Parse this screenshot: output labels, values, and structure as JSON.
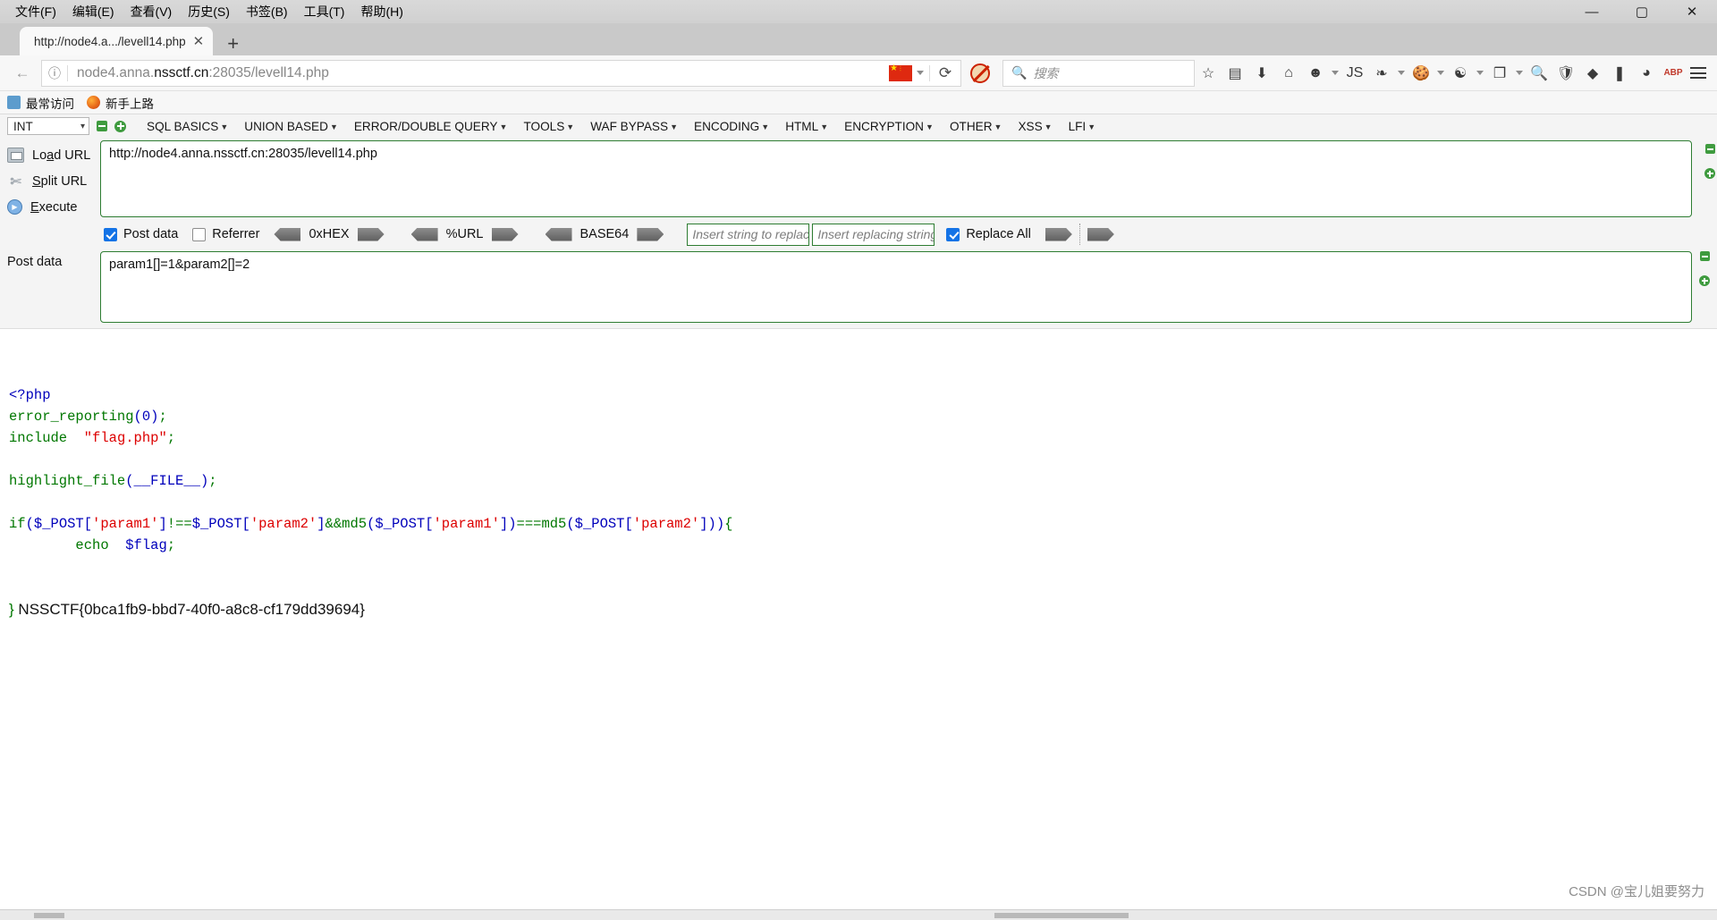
{
  "window": {
    "menu": [
      {
        "label": "文件(F)"
      },
      {
        "label": "编辑(E)"
      },
      {
        "label": "查看(V)"
      },
      {
        "label": "历史(S)"
      },
      {
        "label": "书签(B)"
      },
      {
        "label": "工具(T)"
      },
      {
        "label": "帮助(H)"
      }
    ],
    "minimize": "—",
    "maximize": "▢",
    "close": "✕"
  },
  "tabs": {
    "active": {
      "title": "http://node4.a.../levell14.php",
      "close": "✕"
    },
    "new_tab": "+"
  },
  "nav": {
    "back": "←",
    "identity_icon": "ⓘ",
    "url_prefix": "node4.anna.",
    "url_domain": "nssctf.cn",
    "url_suffix": ":28035/levell14.php",
    "flag_label": "china-flag",
    "reload": "⟳",
    "noscript": "noscript-icon",
    "search_placeholder": "搜索",
    "search_value": "",
    "icons": [
      {
        "name": "bookmark-star-icon",
        "glyph": "☆"
      },
      {
        "name": "reader-view-icon",
        "glyph": "▤"
      },
      {
        "name": "downloads-icon",
        "glyph": "⬇"
      },
      {
        "name": "home-icon",
        "glyph": "⌂"
      },
      {
        "name": "user-agent-switcher-icon",
        "glyph": "☻"
      },
      {
        "name": "javascript-toggle-icon",
        "glyph": "JS"
      },
      {
        "name": "ie-tab-icon",
        "glyph": "❧"
      },
      {
        "name": "cookie-manager-icon",
        "glyph": "🍪"
      },
      {
        "name": "proxy-switcher-icon",
        "glyph": "☯"
      },
      {
        "name": "copy-pages-icon",
        "glyph": "❐"
      },
      {
        "name": "zoom-icon",
        "glyph": "🔍"
      },
      {
        "name": "shield-icon",
        "glyph": "🛡"
      },
      {
        "name": "gem-icon",
        "glyph": "◆"
      },
      {
        "name": "notes-icon",
        "glyph": "❚"
      },
      {
        "name": "globe-icon",
        "glyph": "◕"
      },
      {
        "name": "adblock-icon",
        "glyph": "ABP"
      }
    ]
  },
  "bookmarks": [
    {
      "label": "最常访问",
      "icon": "most-visited-icon"
    },
    {
      "label": "新手上路",
      "icon": "firefox-getting-started-icon"
    }
  ],
  "hackbar": {
    "type_select": "INT",
    "remove_button": "minus",
    "add_button": "plus",
    "menu": [
      {
        "label": "SQL BASICS"
      },
      {
        "label": "UNION BASED"
      },
      {
        "label": "ERROR/DOUBLE QUERY"
      },
      {
        "label": "TOOLS"
      },
      {
        "label": "WAF BYPASS"
      },
      {
        "label": "ENCODING"
      },
      {
        "label": "HTML"
      },
      {
        "label": "ENCRYPTION"
      },
      {
        "label": "OTHER"
      },
      {
        "label": "XSS"
      },
      {
        "label": "LFI"
      }
    ],
    "actions": [
      {
        "label_pre": "Lo",
        "label_key": "a",
        "label_post": "d URL",
        "name": "load-url"
      },
      {
        "label_pre": "",
        "label_key": "S",
        "label_post": "plit URL",
        "name": "split-url"
      },
      {
        "label_pre": "",
        "label_key": "E",
        "label_post": "xecute",
        "name": "execute"
      }
    ],
    "url_value": "http://node4.anna.nssctf.cn:28035/levell14.php",
    "options": {
      "post_data_label": "Post data",
      "post_data_checked": true,
      "referrer_label": "Referrer",
      "referrer_checked": false,
      "hex_label": "0xHEX",
      "url_label": "%URL",
      "base64_label": "BASE64",
      "replace_find_placeholder": "Insert string to replace",
      "replace_with_placeholder": "Insert replacing string",
      "replace_all_label": "Replace All",
      "replace_all_checked": true
    },
    "post_data_label": "Post data",
    "post_data_value": "param1[]=1&param2[]=2"
  },
  "code": {
    "lines": [
      [
        {
          "t": "<?php",
          "c": "c-tag"
        }
      ],
      [
        {
          "t": "error_reporting",
          "c": "c-kw"
        },
        {
          "t": "(",
          "c": "c-fn"
        },
        {
          "t": "0",
          "c": "c-num"
        },
        {
          "t": ")",
          "c": "c-fn"
        },
        {
          "t": ";",
          "c": "c-kw"
        }
      ],
      [
        {
          "t": "include",
          "c": "c-kw"
        },
        {
          "t": "  ",
          "c": ""
        },
        {
          "t": "\"flag.php\"",
          "c": "c-str"
        },
        {
          "t": ";",
          "c": "c-kw"
        }
      ],
      [],
      [
        {
          "t": "highlight_file",
          "c": "c-kw"
        },
        {
          "t": "(",
          "c": "c-fn"
        },
        {
          "t": "__FILE__",
          "c": "c-var"
        },
        {
          "t": ")",
          "c": "c-fn"
        },
        {
          "t": ";",
          "c": "c-kw"
        }
      ],
      [],
      [
        {
          "t": "if",
          "c": "c-kw"
        },
        {
          "t": "(",
          "c": "c-fn"
        },
        {
          "t": "$_POST",
          "c": "c-var"
        },
        {
          "t": "[",
          "c": "c-fn"
        },
        {
          "t": "'param1'",
          "c": "c-str"
        },
        {
          "t": "]",
          "c": "c-fn"
        },
        {
          "t": "!==",
          "c": "c-kw"
        },
        {
          "t": "$_POST",
          "c": "c-var"
        },
        {
          "t": "[",
          "c": "c-fn"
        },
        {
          "t": "'param2'",
          "c": "c-str"
        },
        {
          "t": "]",
          "c": "c-fn"
        },
        {
          "t": "&&",
          "c": "c-kw"
        },
        {
          "t": "md5",
          "c": "c-kw"
        },
        {
          "t": "(",
          "c": "c-fn"
        },
        {
          "t": "$_POST",
          "c": "c-var"
        },
        {
          "t": "[",
          "c": "c-fn"
        },
        {
          "t": "'param1'",
          "c": "c-str"
        },
        {
          "t": "]",
          "c": "c-fn"
        },
        {
          "t": ")",
          "c": "c-fn"
        },
        {
          "t": "===",
          "c": "c-kw"
        },
        {
          "t": "md5",
          "c": "c-kw"
        },
        {
          "t": "(",
          "c": "c-fn"
        },
        {
          "t": "$_POST",
          "c": "c-var"
        },
        {
          "t": "[",
          "c": "c-fn"
        },
        {
          "t": "'param2'",
          "c": "c-str"
        },
        {
          "t": "]",
          "c": "c-fn"
        },
        {
          "t": "))",
          "c": "c-fn"
        },
        {
          "t": "{",
          "c": "c-kw"
        }
      ],
      [
        {
          "t": "        ",
          "c": ""
        },
        {
          "t": "echo",
          "c": "c-kw"
        },
        {
          "t": "  ",
          "c": ""
        },
        {
          "t": "$flag",
          "c": "c-var"
        },
        {
          "t": ";",
          "c": "c-kw"
        }
      ]
    ],
    "closing_brace": "}",
    "flag": "NSSCTF{0bca1fb9-bbd7-40f0-a8c8-cf179dd39694}"
  },
  "watermark": "CSDN @宝儿姐要努力"
}
